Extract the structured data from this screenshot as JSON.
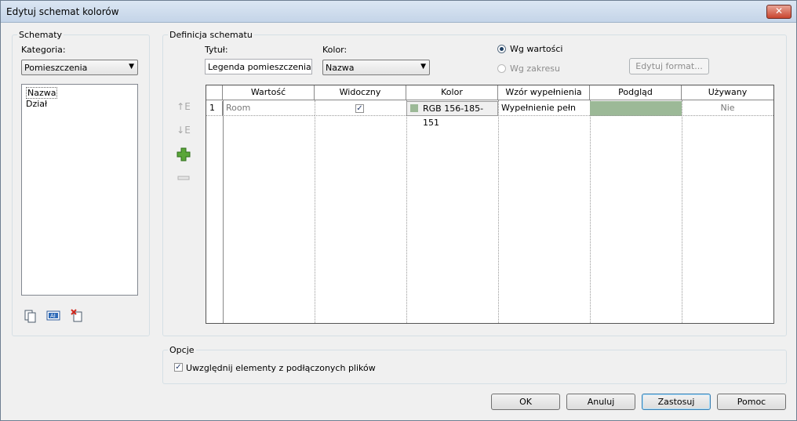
{
  "window": {
    "title": "Edytuj schemat kolorów",
    "close_label": "✕"
  },
  "schemes": {
    "legend": "Schematy",
    "category_label": "Kategoria:",
    "category_value": "Pomieszczenia",
    "items": [
      "Nazwa",
      "Dział"
    ],
    "tools": [
      "duplicate-icon",
      "rename-icon",
      "delete-icon"
    ]
  },
  "definition": {
    "legend": "Definicja schematu",
    "title_label": "Tytuł:",
    "title_value": "Legenda pomieszczenia",
    "color_label": "Kolor:",
    "color_value": "Nazwa",
    "radio_by_value": "Wg wartości",
    "radio_by_range": "Wg zakresu",
    "edit_format_label": "Edytuj format...",
    "side_tools": [
      "move-up-icon",
      "move-down-icon",
      "add-icon",
      "remove-icon"
    ],
    "table": {
      "columns": [
        "Wartość",
        "Widoczny",
        "Kolor",
        "Wzór wypełnienia",
        "Podgląd",
        "Używany"
      ],
      "rows": [
        {
          "num": "1",
          "value": "Room",
          "visible": true,
          "color": "RGB 156-185-151",
          "fill": "Wypełnienie pełn",
          "used": "Nie",
          "swatch": "#9cb997"
        }
      ]
    }
  },
  "options": {
    "legend": "Opcje",
    "include_linked_label": "Uwzględnij elementy z podłączonych plików",
    "include_linked": true
  },
  "buttons": {
    "ok": "OK",
    "cancel": "Anuluj",
    "apply": "Zastosuj",
    "help": "Pomoc"
  }
}
